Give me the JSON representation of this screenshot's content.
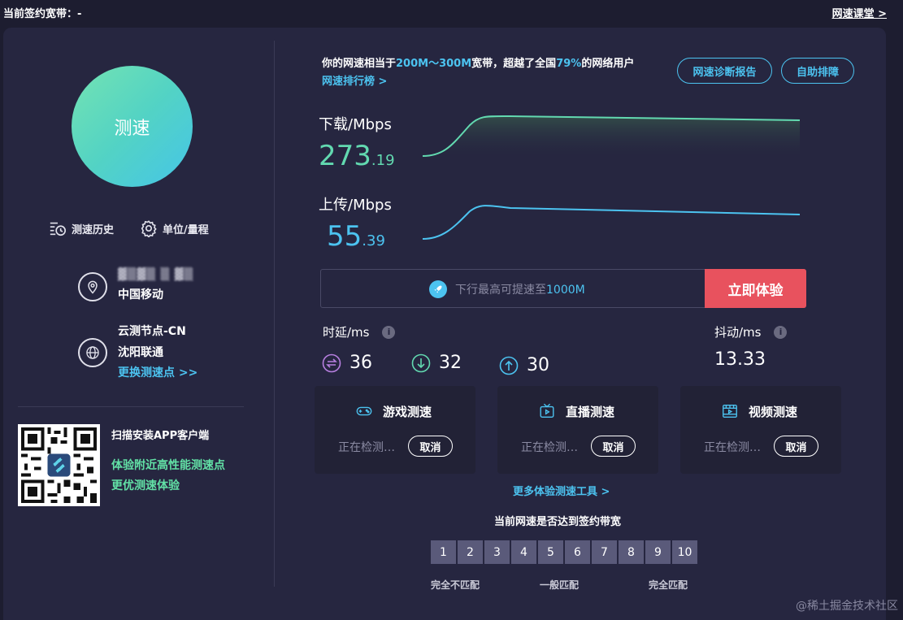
{
  "topbar": {
    "contract_bandwidth": "当前签约宽带：-",
    "course_link": "网速课堂 >"
  },
  "left": {
    "speed_button": "测速",
    "history": "测速历史",
    "units": "单位/量程",
    "ip_masked": "▓▒▓▒ ▒ ▓▒",
    "isp": "中国移动",
    "node_name": "云测节点-CN",
    "node_city": "沈阳联通",
    "change_node": "更换测速点 >>",
    "qr_title": "扫描安装APP客户端",
    "qr_line1": "体验附近高性能测速点",
    "qr_line2": "更优测速体验"
  },
  "summary": {
    "prefix": "你的网速相当于",
    "range": "200M～300M",
    "mid": "宽带，超越了全国",
    "percent": "79%",
    "suffix": "的网络用户",
    "rank_link": "网速排行榜 >",
    "diagnosis_button": "网速诊断报告",
    "self_check_button": "自助排障"
  },
  "download": {
    "label": "下载/Mbps",
    "int": "273",
    "dec": ".19",
    "color": "#62d9b0"
  },
  "upload": {
    "label": "上传/Mbps",
    "int": "55",
    "dec": ".39",
    "color": "#4cc3f0"
  },
  "promo": {
    "text_prefix": "下行最高可提速至",
    "text_value": "1000M",
    "button": "立即体验"
  },
  "latency": {
    "label": "时延/ms",
    "values": [
      "36",
      "32",
      "30"
    ]
  },
  "jitter": {
    "label": "抖动/ms",
    "value": "13.33"
  },
  "cards": [
    {
      "title": "游戏测速",
      "status": "正在检测…",
      "cancel": "取消"
    },
    {
      "title": "直播测速",
      "status": "正在检测…",
      "cancel": "取消"
    },
    {
      "title": "视频测速",
      "status": "正在检测…",
      "cancel": "取消"
    }
  ],
  "more_tools": "更多体验测速工具 >",
  "match": {
    "title": "当前网速是否达到签约带宽",
    "scale": [
      "1",
      "2",
      "3",
      "4",
      "5",
      "6",
      "7",
      "8",
      "9",
      "10"
    ],
    "low": "完全不匹配",
    "mid": "一般匹配",
    "high": "完全匹配"
  },
  "watermark": "@稀土掘金技术社区",
  "colors": {
    "accent": "#4cc3f0",
    "green": "#62e1a6",
    "red": "#e8525e",
    "panel": "#262640"
  }
}
